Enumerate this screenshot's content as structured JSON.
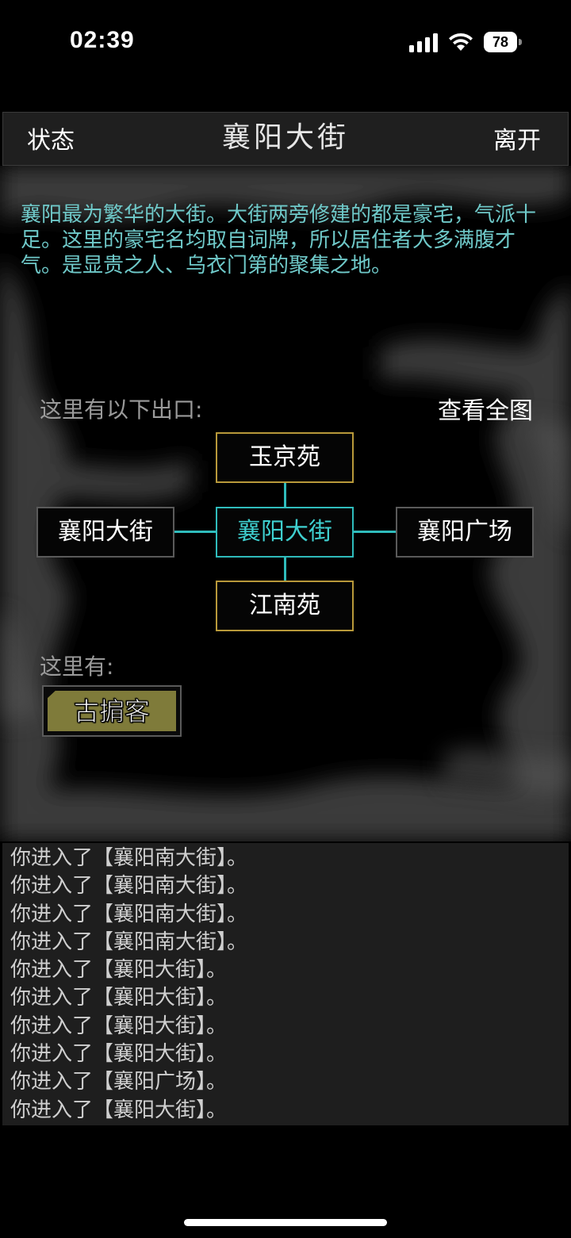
{
  "status_bar": {
    "time": "02:39",
    "battery": "78"
  },
  "header": {
    "left_button": "状态",
    "title": "襄阳大街",
    "right_button": "离开"
  },
  "scene": {
    "description": "襄阳最为繁华的大街。大街两旁修建的都是豪宅，气派十足。这里的豪宅名均取自词牌，所以居住者大多满腹才气。是显贵之人、乌衣门第的聚集之地。",
    "exits_label": "这里有以下出口:",
    "view_map_label": "查看全图",
    "exits": {
      "north": "玉京苑",
      "west": "襄阳大街",
      "current": "襄阳大街",
      "east": "襄阳广场",
      "south": "江南苑"
    },
    "here_label": "这里有:",
    "npcs": [
      "古掮客"
    ]
  },
  "log": [
    "你进入了【襄阳南大街】。",
    "你进入了【襄阳南大街】。",
    "你进入了【襄阳南大街】。",
    "你进入了【襄阳南大街】。",
    "你进入了【襄阳大街】。",
    "你进入了【襄阳大街】。",
    "你进入了【襄阳大街】。",
    "你进入了【襄阳大街】。",
    "你进入了【襄阳广场】。",
    "你进入了【襄阳大街】。"
  ],
  "colors": {
    "description_text": "#6fc9c9",
    "current_room_border": "#2fbcbc",
    "exit_border_gold": "#b8993a",
    "exit_border_gray": "#5a5a5a",
    "npc_button_fill": "#7f7b3a"
  }
}
